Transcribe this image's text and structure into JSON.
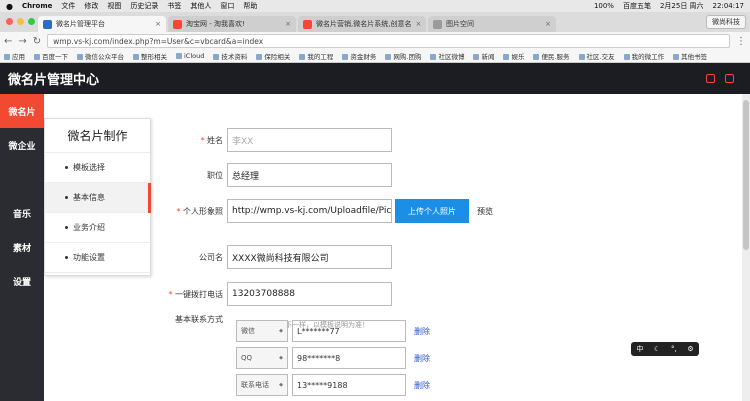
{
  "macbar": {
    "app": "Chrome",
    "menus": [
      "文件",
      "修改",
      "视图",
      "历史记录",
      "书签",
      "其他人",
      "窗口",
      "帮助"
    ],
    "battery": "100%",
    "input_method": "百度五笔",
    "date": "2月25日 周六",
    "time": "22:04:17"
  },
  "tabs": [
    {
      "title": "微名片管理平台",
      "color": "#2b6cc4"
    },
    {
      "title": "淘宝网 - 淘我喜欢!",
      "color": "#f24a32"
    },
    {
      "title": "微名片营销,微名片系统,创意名",
      "color": "#f24a32"
    },
    {
      "title": "图片空间",
      "color": "#9a9a9a"
    }
  ],
  "profile": "微尚科技",
  "address": {
    "url": "wmp.vs-kj.com/index.php?m=User&c=vbcard&a=index"
  },
  "bookmarks": [
    "应用",
    "百度一下",
    "微信公众平台",
    "整形相关",
    "iCloud",
    "技术资料",
    "保险相关",
    "我的工程",
    "资金财务",
    "网购.团购",
    "社区微博",
    "新闻",
    "娱乐",
    "便民.服务",
    "社区.交友",
    "我的微工作",
    "其他书签"
  ],
  "app": {
    "title": "微名片管理中心"
  },
  "leftnav": [
    {
      "label": "微名片"
    },
    {
      "label": "微企业"
    },
    {
      "label": ""
    },
    {
      "label": "音乐"
    },
    {
      "label": "素材"
    },
    {
      "label": "设置"
    }
  ],
  "submenu": {
    "title": "微名片制作",
    "items": [
      {
        "label": "模板选择"
      },
      {
        "label": "基本信息"
      },
      {
        "label": "业务介绍"
      },
      {
        "label": "功能设置"
      }
    ]
  },
  "form": {
    "name": {
      "label": "姓名",
      "value": "李XX"
    },
    "position": {
      "label": "职位",
      "value": "总经理"
    },
    "photo": {
      "label": "个人形象照",
      "value": "http://wmp.vs-kj.com/Uploadfile/Pictu",
      "upload": "上传个人照片",
      "preview": "预览",
      "hint": "不同模板，尺寸不一样，以模板说明为准！"
    },
    "company": {
      "label": "公司名",
      "value": "XXXX微尚科技有限公司"
    },
    "phone": {
      "label": "一键拨打电话",
      "value": "13203708888"
    },
    "contacts": {
      "label": "基本联系方式",
      "rows": [
        {
          "type": "微信",
          "value": "L*******77",
          "action": "删除"
        },
        {
          "type": "QQ",
          "value": "98*******8",
          "action": "删除"
        },
        {
          "type": "联系电话",
          "value": "13*****9188",
          "action": "删除"
        }
      ]
    }
  },
  "ime": {
    "symbols": [
      "中",
      "☾",
      "°,",
      "⚙"
    ]
  }
}
